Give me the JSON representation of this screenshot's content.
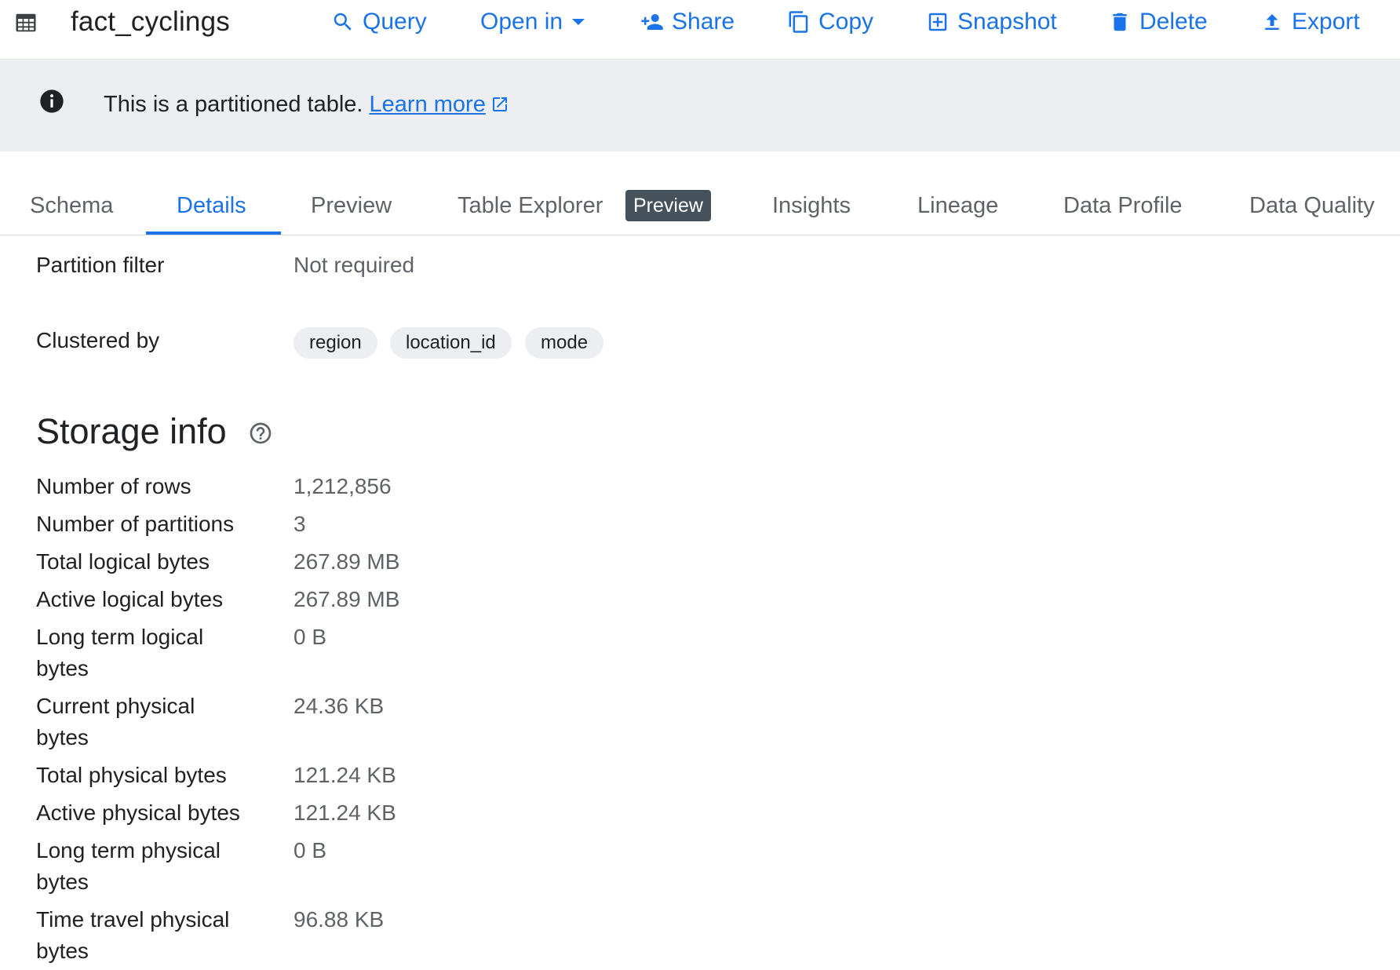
{
  "header": {
    "title": "fact_cyclings",
    "actions": {
      "query": "Query",
      "open_in": "Open in",
      "share": "Share",
      "copy": "Copy",
      "snapshot": "Snapshot",
      "delete": "Delete",
      "export": "Export"
    },
    "accent_color": "#1a73e8"
  },
  "banner": {
    "text": "This is a partitioned table.",
    "link": "Learn more"
  },
  "tabs": {
    "schema": "Schema",
    "details": "Details",
    "preview": "Preview",
    "table_explorer": "Table Explorer",
    "table_explorer_badge": "Preview",
    "insights": "Insights",
    "lineage": "Lineage",
    "data_profile": "Data Profile",
    "data_quality": "Data Quality",
    "active": "Details"
  },
  "details": {
    "partition_filter_label": "Partition filter",
    "partition_filter_value": "Not required",
    "clustered_by_label": "Clustered by",
    "clustered_by": [
      "region",
      "location_id",
      "mode"
    ]
  },
  "storage": {
    "title": "Storage info",
    "rows": [
      {
        "label": "Number of rows",
        "value": "1,212,856"
      },
      {
        "label": "Number of partitions",
        "value": "3"
      },
      {
        "label": "Total logical bytes",
        "value": "267.89 MB"
      },
      {
        "label": "Active logical bytes",
        "value": "267.89 MB"
      },
      {
        "label": "Long term logical bytes",
        "value": "0 B"
      },
      {
        "label": "Current physical bytes",
        "value": "24.36 KB"
      },
      {
        "label": "Total physical bytes",
        "value": "121.24 KB"
      },
      {
        "label": "Active physical bytes",
        "value": "121.24 KB"
      },
      {
        "label": "Long term physical bytes",
        "value": "0 B"
      },
      {
        "label": "Time travel physical bytes",
        "value": "96.88 KB"
      }
    ]
  }
}
